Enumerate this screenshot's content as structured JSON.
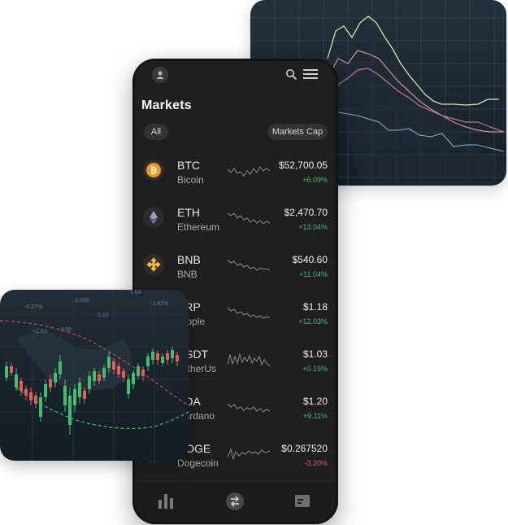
{
  "header": {
    "title": "Markets"
  },
  "filters": {
    "all_label": "All",
    "sort_label": "Markets Cap"
  },
  "coins": [
    {
      "symbol": "BTC",
      "name": "Bicoin",
      "price": "$52,700.05",
      "change": "+6.09%",
      "trend": "up",
      "icon": "bitcoin-icon"
    },
    {
      "symbol": "ETH",
      "name": "Ethereum",
      "price": "$2,470.70",
      "change": "+13.04%",
      "trend": "up",
      "icon": "ethereum-icon"
    },
    {
      "symbol": "BNB",
      "name": "BNB",
      "price": "$540.60",
      "change": "+11.04%",
      "trend": "up",
      "icon": "bnb-icon"
    },
    {
      "symbol": "XRP",
      "name": "Ripple",
      "price": "$1.18",
      "change": "+12.03%",
      "trend": "up",
      "icon": "xrp-icon"
    },
    {
      "symbol": "USDT",
      "name": "TetherUs",
      "price": "$1.03",
      "change": "+0.15%",
      "trend": "up",
      "icon": "tether-icon"
    },
    {
      "symbol": "ADA",
      "name": "Cardano",
      "price": "$1.20",
      "change": "+9.11%",
      "trend": "up",
      "icon": "cardano-icon"
    },
    {
      "symbol": "DOGE",
      "name": "Dogecoin",
      "price": "$0.267520",
      "change": "-3.20%",
      "trend": "down",
      "icon": "dogecoin-icon"
    }
  ],
  "candle_overlay": {
    "labels": [
      "-0.27%",
      "2,000",
      "-1.41%",
      "+1.60",
      "-0.08",
      "1.64",
      "5,10"
    ]
  },
  "colors": {
    "accent_up": "#3fbf6e",
    "accent_down": "#e55c5c",
    "bitcoin": "#f7931a",
    "bnb": "#f3ba2f",
    "ethereum": "#8ea2c8"
  },
  "icons": {
    "user": "user-icon",
    "search": "search-icon",
    "menu": "menu-icon",
    "tab_markets": "bar-chart-icon",
    "tab_trade": "swap-icon",
    "tab_wallet": "wallet-icon"
  }
}
